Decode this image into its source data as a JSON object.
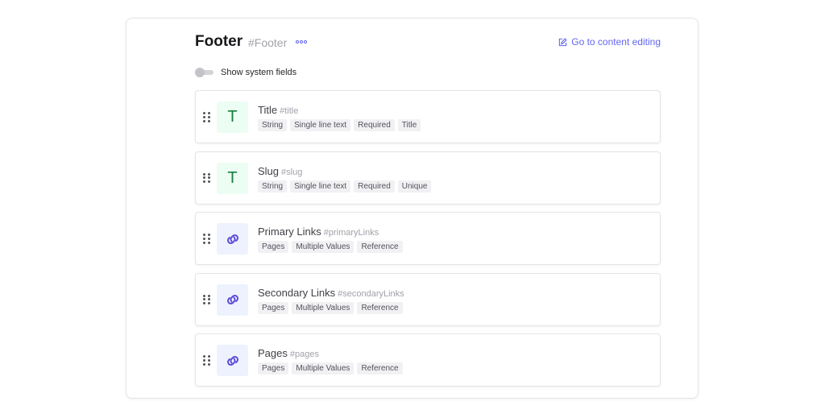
{
  "model": {
    "title": "Footer",
    "api_id": "#Footer",
    "edit_link": "Go to content editing",
    "more_icon": "more-dots-icon",
    "edit_icon": "edit-icon"
  },
  "system_toggle": {
    "label": "Show system fields",
    "enabled": false
  },
  "colors": {
    "accent": "#6366f1",
    "text_icon_bg": "#ecfdf3",
    "text_icon_fg": "#15803d",
    "link_icon_bg": "#eef2ff"
  },
  "fields": [
    {
      "icon": "T",
      "icon_type": "text",
      "name": "Title",
      "api_id": "#title",
      "tags": [
        "String",
        "Single line text",
        "Required",
        "Title"
      ]
    },
    {
      "icon": "T",
      "icon_type": "text",
      "name": "Slug",
      "api_id": "#slug",
      "tags": [
        "String",
        "Single line text",
        "Required",
        "Unique"
      ]
    },
    {
      "icon": "link-icon",
      "icon_type": "link",
      "name": "Primary Links",
      "api_id": "#primaryLinks",
      "tags": [
        "Pages",
        "Multiple Values",
        "Reference"
      ]
    },
    {
      "icon": "link-icon",
      "icon_type": "link",
      "name": "Secondary Links",
      "api_id": "#secondaryLinks",
      "tags": [
        "Pages",
        "Multiple Values",
        "Reference"
      ]
    },
    {
      "icon": "link-icon",
      "icon_type": "link",
      "name": "Pages",
      "api_id": "#pages",
      "tags": [
        "Pages",
        "Multiple Values",
        "Reference"
      ]
    }
  ]
}
